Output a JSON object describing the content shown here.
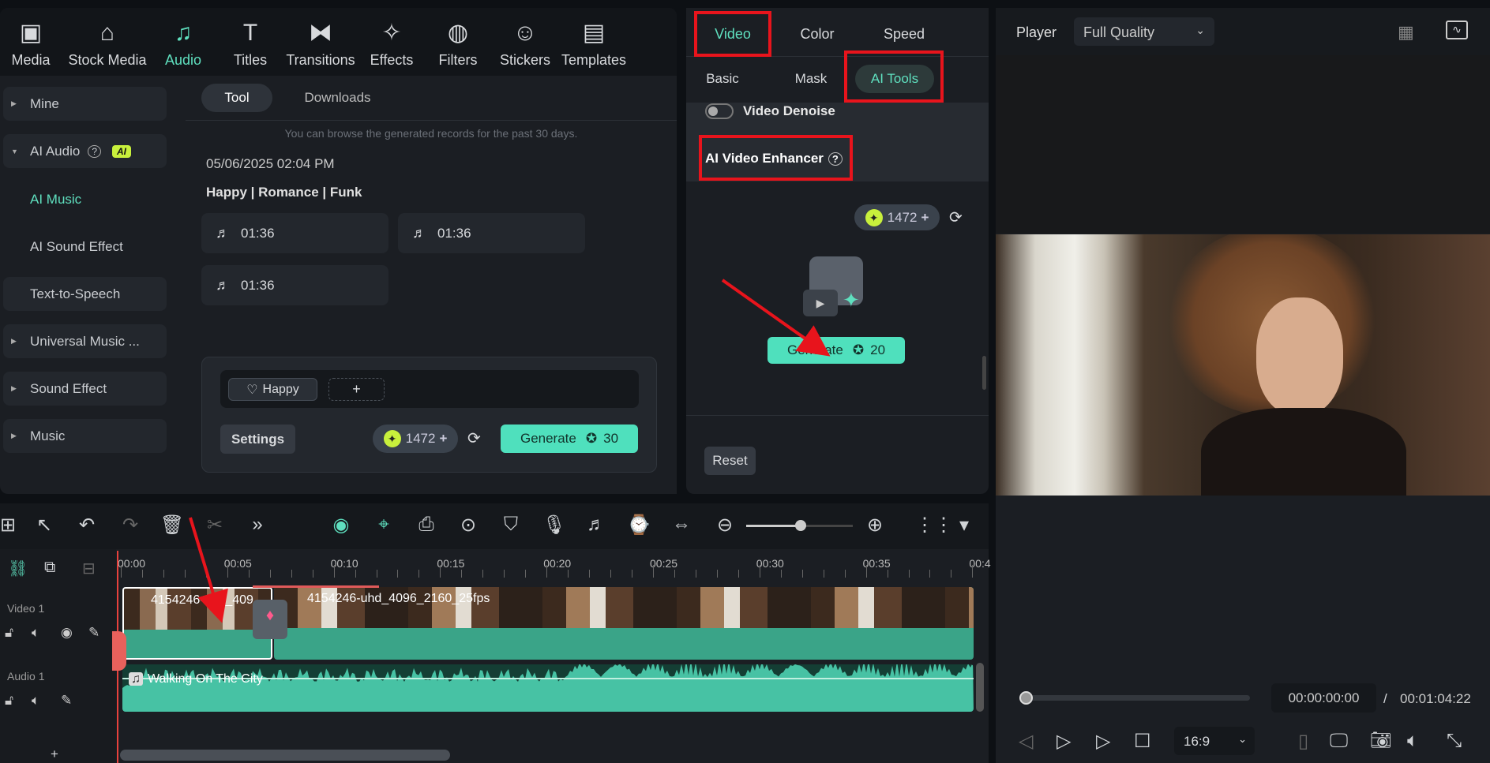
{
  "toolbar": {
    "items": [
      {
        "label": "Media",
        "icon": "media-icon",
        "glyph": "▣"
      },
      {
        "label": "Stock Media",
        "icon": "stock-media-icon",
        "glyph": "⌂"
      },
      {
        "label": "Audio",
        "icon": "audio-icon",
        "glyph": "♫"
      },
      {
        "label": "Titles",
        "icon": "titles-icon",
        "glyph": "T"
      },
      {
        "label": "Transitions",
        "icon": "transitions-icon",
        "glyph": "⧓"
      },
      {
        "label": "Effects",
        "icon": "effects-icon",
        "glyph": "✧"
      },
      {
        "label": "Filters",
        "icon": "filters-icon",
        "glyph": "◍"
      },
      {
        "label": "Stickers",
        "icon": "stickers-icon",
        "glyph": "☺"
      },
      {
        "label": "Templates",
        "icon": "templates-icon",
        "glyph": "▤"
      }
    ],
    "active": "Audio"
  },
  "sidebar": {
    "items": [
      {
        "label": "Mine"
      },
      {
        "label": "AI Audio",
        "badge": "AI"
      },
      {
        "label": "AI Music"
      },
      {
        "label": "AI Sound Effect"
      },
      {
        "label": "Text-to-Speech"
      },
      {
        "label": "Universal Music ..."
      },
      {
        "label": "Sound Effect"
      },
      {
        "label": "Music"
      }
    ]
  },
  "audio_panel": {
    "tabs": [
      "Tool",
      "Downloads"
    ],
    "note": "You can browse the generated records for the past 30 days.",
    "date": "05/06/2025 02:04 PM",
    "tags": "Happy | Romance | Funk",
    "tracks": [
      "01:36",
      "01:36",
      "01:36"
    ],
    "chip": "Happy",
    "add": "+",
    "settings": "Settings",
    "credits": "1472",
    "generate": "Generate",
    "cost": "30"
  },
  "props": {
    "tabs": [
      "Video",
      "Color",
      "Speed"
    ],
    "subtabs": [
      "Basic",
      "Mask",
      "AI Tools"
    ],
    "denoise": "Video Denoise",
    "enhancer": "AI Video Enhancer",
    "credits": "1472",
    "generate": "Generate",
    "cost": "20",
    "reset": "Reset"
  },
  "player": {
    "label": "Player",
    "quality": "Full Quality",
    "current": "00:00:00:00",
    "sep": "/",
    "total": "00:01:04:22",
    "ratio": "16:9",
    "progress": 0
  },
  "timeline": {
    "ruler": [
      "00:00",
      "00:05",
      "00:10",
      "00:15",
      "00:20",
      "00:25",
      "00:30",
      "00:35",
      "00:4"
    ],
    "video_track": "Video 1",
    "audio_track": "Audio 1",
    "clip1": "4154246-uhd_409",
    "clip2": "4154246-uhd_4096_2160_25fps",
    "audio_clip": "Walking On The City",
    "add": "+"
  },
  "colors": {
    "accent": "#4fe0bd",
    "annotation": "#e8141c",
    "credit": "#c8f03c"
  }
}
